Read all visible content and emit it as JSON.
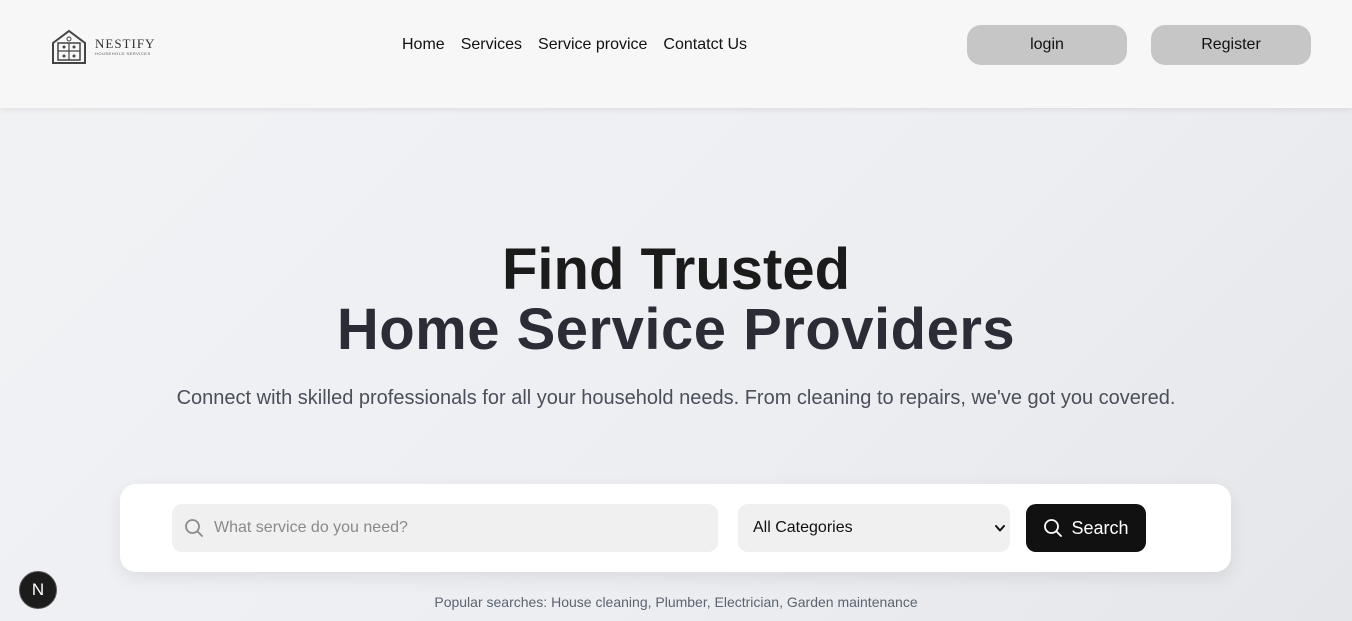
{
  "header": {
    "logo": {
      "name": "NESTIFY",
      "tagline": "HOUSEHOLD SERVICES"
    },
    "nav": [
      "Home",
      "Services",
      "Service provice",
      "Contatct Us"
    ],
    "login_label": "login",
    "register_label": "Register"
  },
  "hero": {
    "title_line1": "Find Trusted",
    "title_line2": "Home Service Providers",
    "subtitle": "Connect with skilled professionals for all your household needs. From cleaning to repairs, we've got you covered."
  },
  "search": {
    "placeholder": "What service do you need?",
    "category_value": "All Categories",
    "button_label": "Search"
  },
  "popular": "Popular searches: House cleaning, Plumber, Electrician, Garden maintenance",
  "badge": {
    "letter": "N"
  },
  "icons": [
    "house-logo-icon",
    "search-icon",
    "chevron-down-icon"
  ]
}
